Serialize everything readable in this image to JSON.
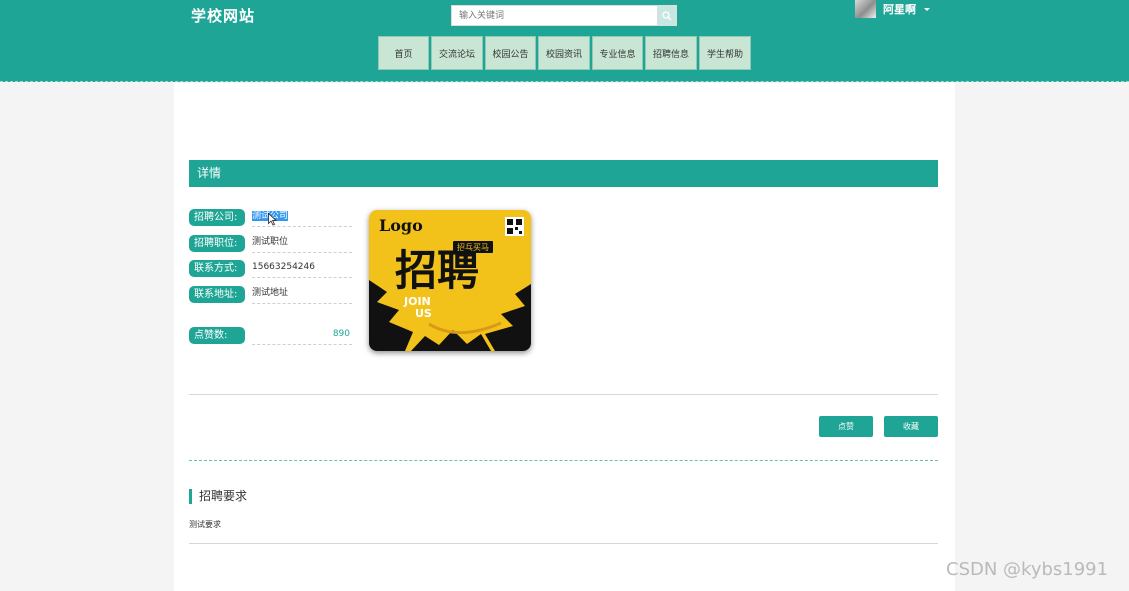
{
  "header": {
    "site_title": "学校网站",
    "search_placeholder": "输入关键词",
    "username": "阿星啊"
  },
  "nav": [
    {
      "label": "首页"
    },
    {
      "label": "交流论坛"
    },
    {
      "label": "校园公告"
    },
    {
      "label": "校园资讯"
    },
    {
      "label": "专业信息"
    },
    {
      "label": "招聘信息"
    },
    {
      "label": "学生帮助"
    }
  ],
  "detail": {
    "section_title": "详情",
    "company_label": "招聘公司:",
    "company_value": "测试公司",
    "position_label": "招聘职位:",
    "position_value": "测试职位",
    "contact_label": "联系方式:",
    "contact_value": "15663254246",
    "address_label": "联系地址:",
    "address_value": "测试地址",
    "likes_label": "点赞数:",
    "likes_value": "890"
  },
  "poster": {
    "logo": "Logo",
    "main_text": "招聘",
    "tag": "招兵买马",
    "join": "JOIN",
    "us": "US"
  },
  "actions": {
    "like_label": "点赞",
    "favorite_label": "收藏"
  },
  "requirements": {
    "title": "招聘要求",
    "text": "测试要求"
  },
  "watermark": "CSDN @kybs1991",
  "colors": {
    "primary": "#1fa596",
    "nav_bg": "#c9e6d5",
    "selection": "#3398f2"
  }
}
